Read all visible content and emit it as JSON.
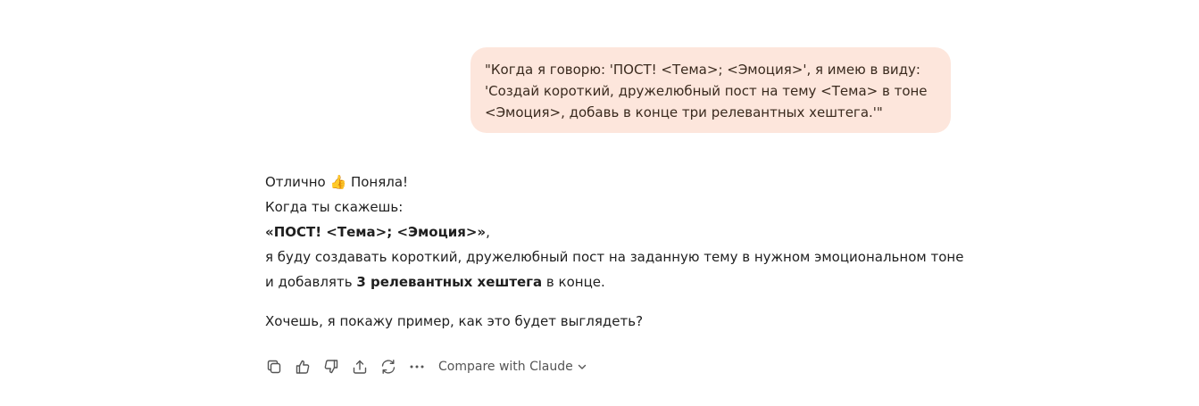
{
  "user_message": {
    "lines": [
      "\"Когда я говорю: 'ПОСТ! <Тема>; <Эмоция>', я имею в виду:",
      "'Создай короткий, дружелюбный пост на тему <Тема> в тоне",
      "<Эмоция>, добавь в конце три релевантных хештега.'\""
    ]
  },
  "assistant_message": {
    "line1": "Отлично 👍 Поняла!",
    "line2": "Когда ты скажешь:",
    "line3_bold": "«ПОСТ! <Тема>; <Эмоция>»",
    "line3_tail": ",",
    "line4": "я буду создавать короткий, дружелюбный пост на заданную тему в нужном эмоциональном тоне",
    "line5_pre": "и добавлять ",
    "line5_bold": "3 релевантных хештега",
    "line5_post": " в конце.",
    "line6": "Хочешь, я покажу пример, как это будет выглядеть?"
  },
  "actions": {
    "icons": [
      "copy-icon",
      "thumbs-up-icon",
      "thumbs-down-icon",
      "share-icon",
      "regenerate-icon",
      "more-icon"
    ],
    "compare_label": "Compare with Claude"
  },
  "colors": {
    "user_bubble_bg": "#fde6dc",
    "user_text": "#3a2a1e",
    "body_text": "#1f1f1f",
    "icon_color": "#555555"
  }
}
